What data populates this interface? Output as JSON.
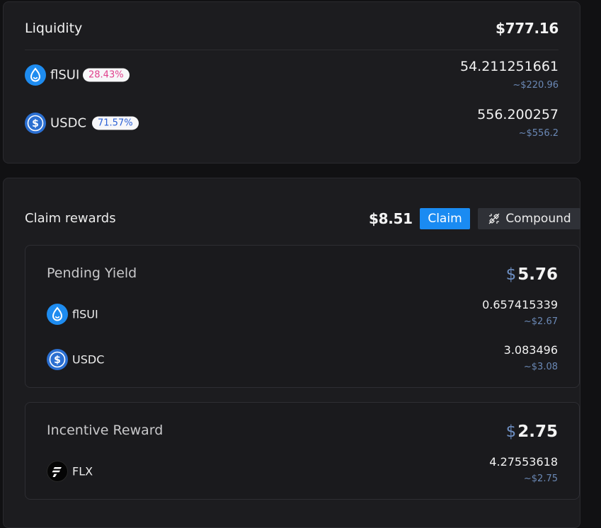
{
  "liquidity": {
    "title": "Liquidity",
    "total": "$777.16",
    "tokens": [
      {
        "name": "flSUI",
        "percent": "28.43%",
        "amount": "54.211251661",
        "usd": "~$220.96"
      },
      {
        "name": "USDC",
        "percent": "71.57%",
        "amount": "556.200257",
        "usd": "~$556.2"
      }
    ]
  },
  "rewards": {
    "title": "Claim rewards",
    "total": "$8.51",
    "claim_label": "Claim",
    "compound_label": "Compound",
    "pending": {
      "title": "Pending Yield",
      "dollar": "$",
      "total": "5.76",
      "tokens": [
        {
          "name": "flSUI",
          "amount": "0.657415339",
          "usd": "~$2.67"
        },
        {
          "name": "USDC",
          "amount": "3.083496",
          "usd": "~$3.08"
        }
      ]
    },
    "incentive": {
      "title": "Incentive Reward",
      "dollar": "$",
      "total": "2.75",
      "tokens": [
        {
          "name": "FLX",
          "amount": "4.27553618",
          "usd": "~$2.75"
        }
      ]
    }
  },
  "colors": {
    "background": "#111113",
    "card": "#1c1c1f",
    "accent": "#1a8bf2",
    "pink": "#e1418d",
    "blue_badge": "#2c61d6",
    "muted_usd": "#6a88b5"
  },
  "icons": [
    "flsui-icon",
    "usdc-icon",
    "flx-icon",
    "compound-icon"
  ]
}
